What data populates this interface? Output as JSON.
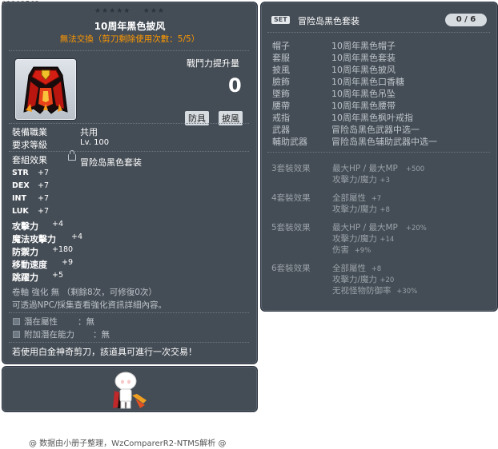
{
  "item_id": "01102562",
  "tooltip": {
    "stars_a": "★★★★★",
    "stars_b": "★★★",
    "title": "10周年黑色披风",
    "trade_note": "無法交換（剪刀剩除使用次數：5/5）",
    "power_label": "戰鬥力提升量",
    "power_value": "0",
    "tags": [
      "防具",
      "披風"
    ],
    "job_label": "裝備職業",
    "job_value": "共用",
    "level_label": "要求等級",
    "level_value": "Lv. 100",
    "set_label": "套組效果",
    "set_value": "冒险岛黑色套装",
    "stats": [
      {
        "name": "STR",
        "value": "+7"
      },
      {
        "name": "DEX",
        "value": "+7"
      },
      {
        "name": "INT",
        "value": "+7"
      },
      {
        "name": "LUK",
        "value": "+7"
      },
      {
        "name": "攻擊力",
        "value": "+4"
      },
      {
        "name": "魔法攻擊力",
        "value": "+4"
      },
      {
        "name": "防禦力",
        "value": "+180"
      },
      {
        "name": "移動速度",
        "value": "+9"
      },
      {
        "name": "跳躍力",
        "value": "+5"
      }
    ],
    "enhance_line": "卷軸 強化 無 （剩餘8次，可修復0次）",
    "npc_line": "可透過NPC/採集查看強化資訊詳細內容。",
    "potential_label": "潛在屬性",
    "potential_value": "：無",
    "add_potential_label": "附加潛在能力",
    "add_potential_value": "：無",
    "scissors_note": "若使用白金神奇剪刀，該道具可進行一次交易！"
  },
  "set_panel": {
    "badge": "SET",
    "name": "冒险岛黑色套装",
    "count": "0 / 6",
    "pieces": [
      {
        "part": "帽子",
        "name": "10周年黑色帽子"
      },
      {
        "part": "套服",
        "name": "10周年黑色套装"
      },
      {
        "part": "披風",
        "name": "10周年黑色披风"
      },
      {
        "part": "臉飾",
        "name": "10周年黑色口香糖"
      },
      {
        "part": "墜飾",
        "name": "10周年黑色吊坠"
      },
      {
        "part": "腰帶",
        "name": "10周年黑色腰带"
      },
      {
        "part": "戒指",
        "name": "10周年黑色枫叶戒指"
      },
      {
        "part": "武器",
        "name": "冒险岛黑色武器中选一"
      },
      {
        "part": "輔助武器",
        "name": "冒险岛黑色辅助武器中选一"
      }
    ],
    "effects": [
      {
        "title": "3套裝效果",
        "lines": [
          {
            "t": "最大HP / 最大MP",
            "n": "+500"
          },
          {
            "t": "攻擊力/魔力",
            "n": "+3"
          }
        ]
      },
      {
        "title": "4套裝效果",
        "lines": [
          {
            "t": "全部屬性",
            "n": "+7"
          },
          {
            "t": "攻擊力/魔力",
            "n": "+8"
          }
        ]
      },
      {
        "title": "5套裝效果",
        "lines": [
          {
            "t": "最大HP / 最大MP",
            "n": "+20%"
          },
          {
            "t": "攻擊力/魔力",
            "n": "+14"
          },
          {
            "t": "伤害",
            "n": "+9%"
          }
        ]
      },
      {
        "title": "6套裝效果",
        "lines": [
          {
            "t": "全部屬性",
            "n": "+8"
          },
          {
            "t": "攻擊力/魔力",
            "n": "+20"
          },
          {
            "t": "无视怪物防御率",
            "n": "+30%"
          }
        ]
      }
    ]
  },
  "footer": "@ 数据由小册子整理，WzComparerR2-NTMS解析 @",
  "colors": {
    "panel_bg": "#444c55",
    "trade_orange": "#ff9900",
    "muted_text": "#9aa1a8"
  },
  "icons": [
    "cape-icon",
    "lock-icon",
    "avatar-icon",
    "checkbox-icon"
  ]
}
